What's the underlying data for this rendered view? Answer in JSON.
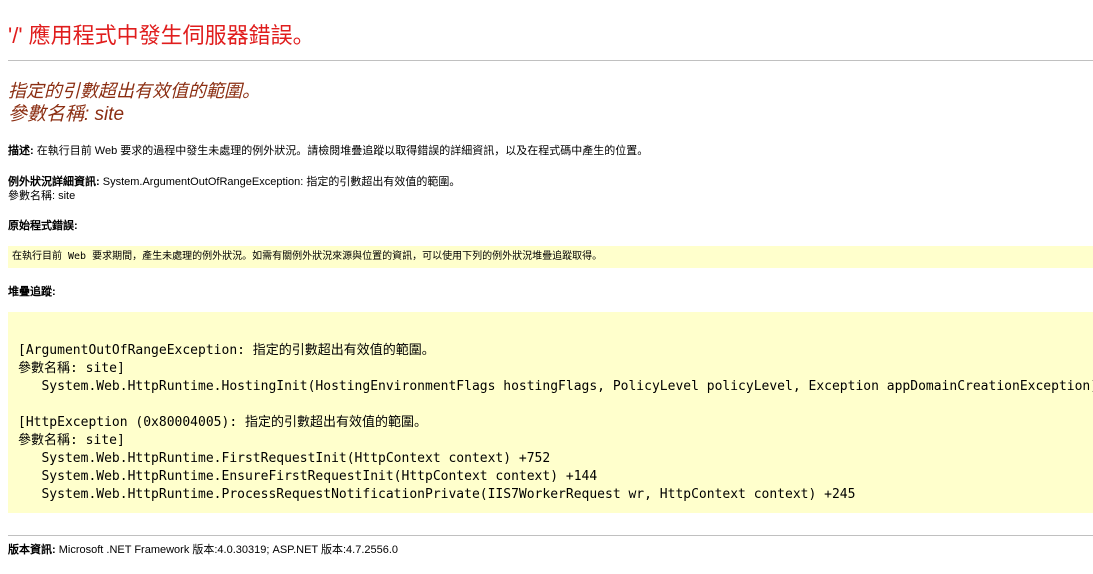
{
  "header": {
    "title": "'/' 應用程式中發生伺服器錯誤。"
  },
  "error": {
    "message": "指定的引數超出有效值的範圍。",
    "param_line": "參數名稱: site"
  },
  "description": {
    "label": "描述:",
    "text": " 在執行目前 Web 要求的過程中發生未處理的例外狀況。請檢閱堆疊追蹤以取得錯誤的詳細資訊，以及在程式碼中產生的位置。"
  },
  "exception_details": {
    "label": "例外狀況詳細資訊:",
    "text": " System.ArgumentOutOfRangeException: 指定的引數超出有效值的範圍。",
    "param_line": "參數名稱: site"
  },
  "source_error": {
    "label": "原始程式錯誤:",
    "text": "在執行目前 Web 要求期間，產生未處理的例外狀況。如需有關例外狀況來源與位置的資訊，可以使用下列的例外狀況堆疊追蹤取得。"
  },
  "stack_trace": {
    "label": "堆疊追蹤:",
    "lines": [
      "[ArgumentOutOfRangeException: 指定的引數超出有效值的範圍。",
      "參數名稱: site]",
      "   System.Web.HttpRuntime.HostingInit(HostingEnvironmentFlags hostingFlags, PolicyLevel policyLevel, Exception appDomainCreationException) +",
      "",
      "[HttpException (0x80004005): 指定的引數超出有效值的範圍。",
      "參數名稱: site]",
      "   System.Web.HttpRuntime.FirstRequestInit(HttpContext context) +752",
      "   System.Web.HttpRuntime.EnsureFirstRequestInit(HttpContext context) +144",
      "   System.Web.HttpRuntime.ProcessRequestNotificationPrivate(IIS7WorkerRequest wr, HttpContext context) +245"
    ]
  },
  "version_info": {
    "label": "版本資訊:",
    "text": " Microsoft .NET Framework 版本:4.0.30319; ASP.NET 版本:4.7.2556.0"
  },
  "colors": {
    "title_red": "#e01d1d",
    "message_maroon": "#8b2e12",
    "code_background": "#ffffcc",
    "rule_gray": "#c0c0c0"
  }
}
